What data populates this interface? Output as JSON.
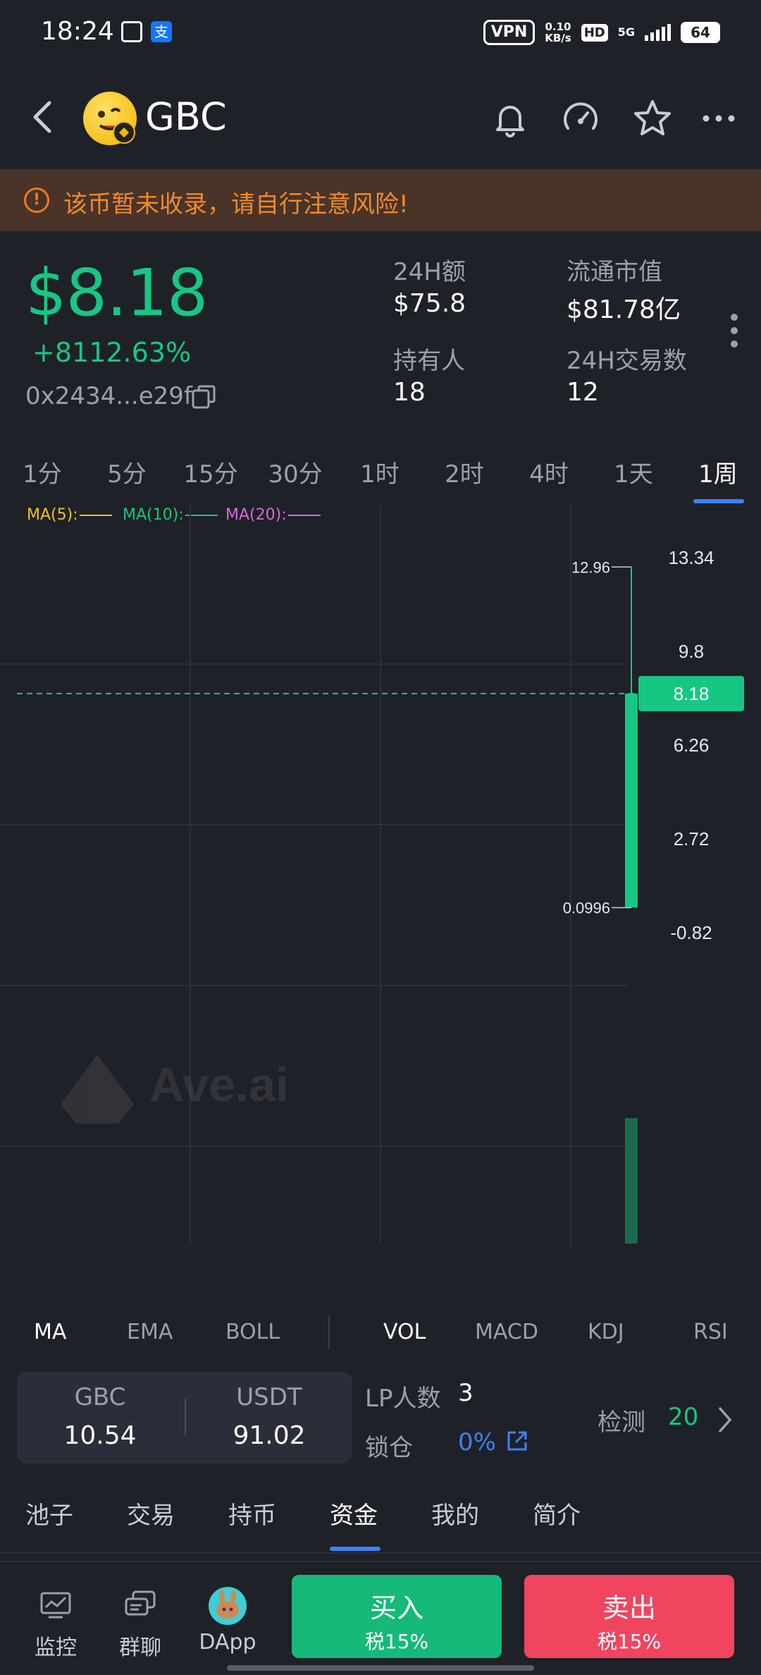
{
  "status_bar": {
    "time": "18:24",
    "vpn": "VPN",
    "net_speed_value": "0.10",
    "net_speed_unit": "KB/s",
    "hd": "HD",
    "network": "5G",
    "battery": "64"
  },
  "header": {
    "token_name": "GBC",
    "icons": [
      "back-icon",
      "bell-icon",
      "gauge-icon",
      "star-icon",
      "more-icon"
    ]
  },
  "warning": {
    "icon": "!",
    "text": "该币暂未收录，请自行注意风险!"
  },
  "price_block": {
    "price": "$8.18",
    "change": "+8112.63%",
    "address": "0x2434...e29f",
    "stats": [
      {
        "label": "24H额",
        "value": "$75.8"
      },
      {
        "label": "流通市值",
        "value": "$81.78亿"
      },
      {
        "label": "持有人",
        "value": "18"
      },
      {
        "label": "24H交易数",
        "value": "12"
      }
    ]
  },
  "timeframes": {
    "tabs": [
      "1分",
      "5分",
      "15分",
      "30分",
      "1时",
      "2时",
      "4时",
      "1天",
      "1周"
    ],
    "active": "1周"
  },
  "chart_data": {
    "type": "candlestick",
    "ma_legend": [
      {
        "label": "MA(5):",
        "color": "#f0c419"
      },
      {
        "label": "MA(10):",
        "color": "#16c784"
      },
      {
        "label": "MA(20):",
        "color": "#d46be0"
      }
    ],
    "y_ticks": [
      "13.34",
      "9.8",
      "6.26",
      "2.72",
      "-0.82"
    ],
    "y_tick_values": [
      13.34,
      9.8,
      6.26,
      2.72,
      -0.82
    ],
    "ylim": [
      -0.82,
      13.34
    ],
    "candles": [
      {
        "open": 0.0996,
        "high": 12.96,
        "low": 0.0996,
        "close": 8.18
      }
    ],
    "high_label": "12.96",
    "low_label": "0.0996",
    "current_price_label": "8.18",
    "current_price": 8.18,
    "watermark": "Ave.ai",
    "up_color": "#16c784"
  },
  "indicators": {
    "main": [
      "MA",
      "EMA",
      "BOLL"
    ],
    "main_active": "MA",
    "sub": [
      "VOL",
      "MACD",
      "KDJ",
      "RSI"
    ],
    "sub_active": "VOL"
  },
  "pool": {
    "token_a": {
      "symbol": "GBC",
      "amount": "10.54"
    },
    "token_b": {
      "symbol": "USDT",
      "amount": "91.02"
    },
    "lp_label": "LP人数",
    "lp_count": "3",
    "lock_label": "锁仓",
    "lock_value": "0%",
    "detect_label": "检测",
    "detect_score": "20"
  },
  "sections": {
    "tabs": [
      "池子",
      "交易",
      "持币",
      "资金",
      "我的",
      "简介"
    ],
    "active": "资金"
  },
  "nav": {
    "items": [
      {
        "label": "监控",
        "icon": "monitor-icon"
      },
      {
        "label": "群聊",
        "icon": "chat-icon"
      },
      {
        "label": "DApp",
        "icon": "pancakeswap-icon"
      }
    ],
    "buy": {
      "label": "买入",
      "tax": "税15%",
      "color": "#16b979"
    },
    "sell": {
      "label": "卖出",
      "tax": "税15%",
      "color": "#f0455f"
    }
  }
}
